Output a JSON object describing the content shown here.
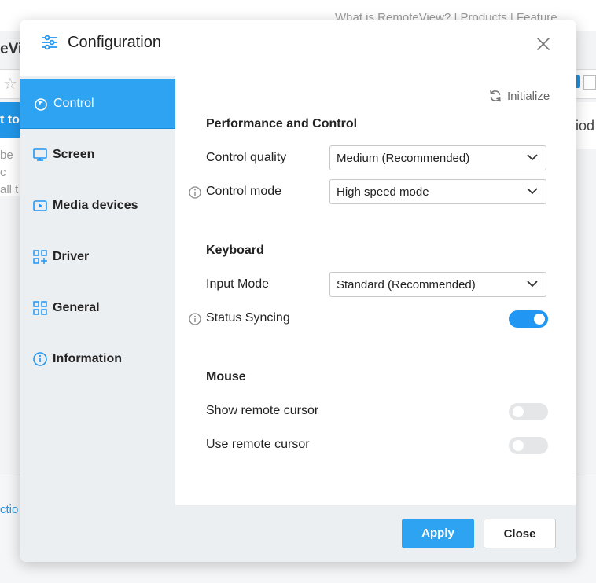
{
  "background": {
    "nav_links": "What is RemoteView?  |  Products  |  Feature",
    "page_title_fragment": "eVi",
    "banner_fragment": "t to",
    "card_fragment_1": "be c",
    "card_fragment_2": "all t",
    "right_fragment": "iod",
    "bottom_fragment": "ctio"
  },
  "dialog": {
    "title": "Configuration",
    "initialize_label": "Initialize",
    "sidebar": [
      {
        "label": "Control",
        "icon": "cursor-icon",
        "active": true
      },
      {
        "label": "Screen",
        "icon": "monitor-icon",
        "active": false
      },
      {
        "label": "Media devices",
        "icon": "media-icon",
        "active": false
      },
      {
        "label": "Driver",
        "icon": "driver-icon",
        "active": false
      },
      {
        "label": "General",
        "icon": "grid-icon",
        "active": false
      },
      {
        "label": "Information",
        "icon": "info-icon",
        "active": false
      }
    ],
    "sections": {
      "performance": {
        "title": "Performance and Control",
        "control_quality_label": "Control quality",
        "control_quality_value": "Medium (Recommended)",
        "control_mode_label": "Control mode",
        "control_mode_value": "High speed mode"
      },
      "keyboard": {
        "title": "Keyboard",
        "input_mode_label": "Input Mode",
        "input_mode_value": "Standard (Recommended)",
        "status_syncing_label": "Status Syncing",
        "status_syncing_on": true
      },
      "mouse": {
        "title": "Mouse",
        "show_cursor_label": "Show remote cursor",
        "show_cursor_on": false,
        "use_cursor_label": "Use remote cursor",
        "use_cursor_on": false
      }
    },
    "apply_label": "Apply",
    "close_label": "Close"
  },
  "colors": {
    "accent": "#2ea3f2",
    "toggle_on": "#2196f3",
    "sidebar_bg": "#ebeff2"
  }
}
